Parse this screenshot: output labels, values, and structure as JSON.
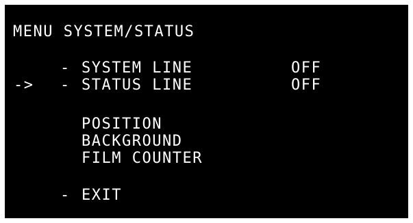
{
  "menu": {
    "title": "MENU SYSTEM/STATUS",
    "cursor": "->",
    "items": [
      {
        "dash": "-",
        "label": "SYSTEM LINE",
        "value": "OFF"
      },
      {
        "dash": "-",
        "label": "STATUS LINE",
        "value": "OFF"
      },
      {
        "label": "POSITION"
      },
      {
        "label": "BACKGROUND"
      },
      {
        "label": "FILM COUNTER"
      },
      {
        "dash": "-",
        "label": "EXIT"
      }
    ]
  },
  "colors": {
    "screen_background": "#000000",
    "text": "#ffffff",
    "frame": "#ffffff"
  }
}
